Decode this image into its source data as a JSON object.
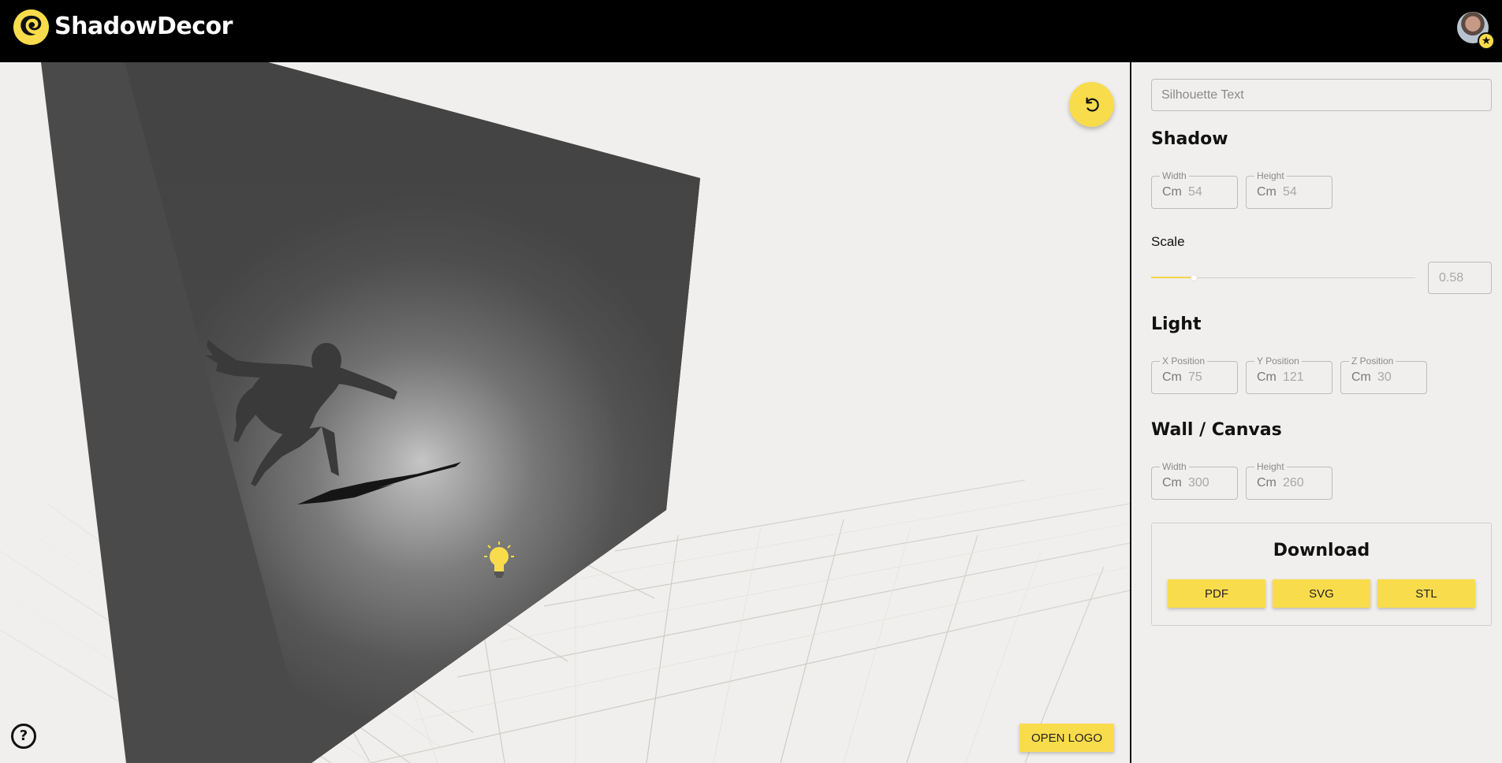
{
  "app": {
    "brand": "ShadowDecor"
  },
  "header": {
    "avatar_icon": "user-avatar",
    "badge_icon": "star-icon"
  },
  "viewport": {
    "reset_icon": "rotate-ccw-icon",
    "help_label": "?",
    "open_logo_label": "OPEN LOGO",
    "light_icon": "lightbulb-icon"
  },
  "panel": {
    "silhouette_placeholder": "Silhouette Text",
    "shadow": {
      "title": "Shadow",
      "width": {
        "label": "Width",
        "unit": "Cm",
        "value": "54"
      },
      "height": {
        "label": "Height",
        "unit": "Cm",
        "value": "54"
      },
      "scale_label": "Scale",
      "scale_value": "0.58",
      "slider_fraction": 0.16
    },
    "light": {
      "title": "Light",
      "x": {
        "label": "X Position",
        "unit": "Cm",
        "value": "75"
      },
      "y": {
        "label": "Y Position",
        "unit": "Cm",
        "value": "121"
      },
      "z": {
        "label": "Z Position",
        "unit": "Cm",
        "value": "30"
      }
    },
    "wall": {
      "title": "Wall / Canvas",
      "width": {
        "label": "Width",
        "unit": "Cm",
        "value": "300"
      },
      "height": {
        "label": "Height",
        "unit": "Cm",
        "value": "260"
      }
    },
    "download": {
      "title": "Download",
      "pdf": "PDF",
      "svg": "SVG",
      "stl": "STL"
    }
  },
  "colors": {
    "accent": "#f9dc4c",
    "header_bg": "#000000",
    "wall": "#4a4a4a",
    "floor": "#e8e8e4"
  }
}
